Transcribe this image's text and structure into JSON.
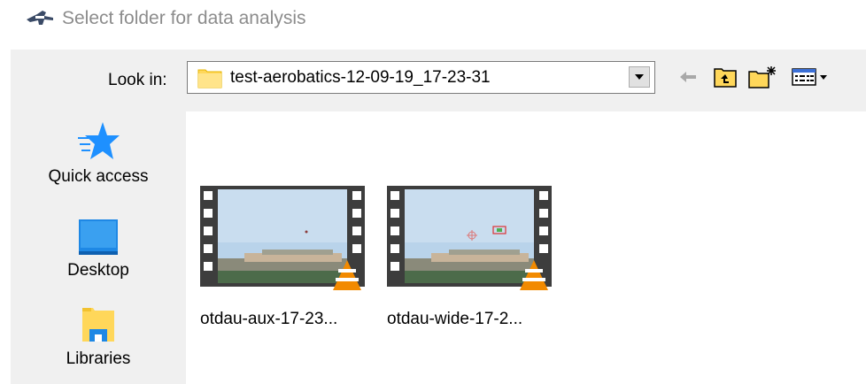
{
  "window": {
    "title": "Select folder for data analysis",
    "title_icon": "aircraft-icon"
  },
  "lookin": {
    "label": "Look in:",
    "value": "test-aerobatics-12-09-19_17-23-31"
  },
  "toolbar": {
    "icons": [
      "back-arrow-icon",
      "up-folder-icon",
      "new-folder-icon",
      "view-menu-icon"
    ]
  },
  "places": [
    {
      "label": "Quick access",
      "icon": "star-icon"
    },
    {
      "label": "Desktop",
      "icon": "desktop-icon"
    },
    {
      "label": "Libraries",
      "icon": "libraries-icon"
    }
  ],
  "files": [
    {
      "label": "otdau-aux-17-23...",
      "icon": "vlc-video-icon"
    },
    {
      "label": "otdau-wide-17-2...",
      "icon": "vlc-video-icon"
    }
  ],
  "colors": {
    "folder": "#ffd75a",
    "accent_blue": "#1e90ff",
    "vlc_orange": "#f28a00"
  }
}
